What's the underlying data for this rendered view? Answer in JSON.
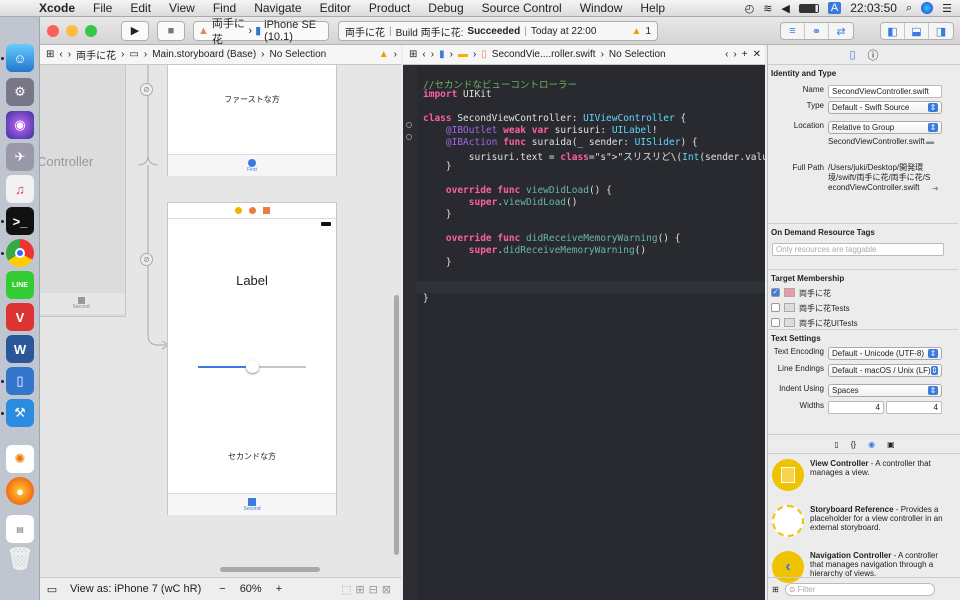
{
  "menubar": {
    "app": "Xcode",
    "items": [
      "File",
      "Edit",
      "View",
      "Find",
      "Navigate",
      "Editor",
      "Product",
      "Debug",
      "Source Control",
      "Window",
      "Help"
    ],
    "user_initial": "A",
    "clock": "22:03:50"
  },
  "toolbar": {
    "scheme": "両手に花",
    "device": "iPhone SE (10.1)",
    "status_app": "両手に花",
    "status_build": "Build 両手に花:",
    "status_result": "Succeeded",
    "status_time": "Today at 22:00",
    "warning_count": "1"
  },
  "canvas_jump": {
    "project": "両手に花",
    "file": "Main.storyboard (Base)",
    "selection": "No Selection"
  },
  "editor_jump": {
    "file": "SecondVie....roller.swift",
    "selection": "No Selection"
  },
  "storyboard": {
    "first_title": "ファーストな方",
    "first_tab": "First",
    "ghost": "Controller",
    "ghost_tab": "Second",
    "label": "Label",
    "second_title": "セカンドな方",
    "second_tab": "Second",
    "slider_value": 0.5
  },
  "canvas_bar": {
    "view_as": "View as: iPhone 7 (wC hR)",
    "zoom": "60%",
    "minus": "−",
    "plus": "+"
  },
  "code": [
    "//セカンドなビューコントローラー",
    "import UIKit",
    "",
    "class SecondViewController: UIViewController {",
    "    @IBOutlet weak var surisuri: UILabel!",
    "    @IBAction func suraida(_ sender: UISlider) {",
    "        surisuri.text = \"スリスリど\\(Int(sender.value))%\"",
    "    }",
    "",
    "    override func viewDidLoad() {",
    "        super.viewDidLoad()",
    "    }",
    "",
    "    override func didReceiveMemoryWarning() {",
    "        super.didReceiveMemoryWarning()",
    "    }",
    "",
    "",
    "}"
  ],
  "inspector": {
    "identity_head": "Identity and Type",
    "name_lbl": "Name",
    "name_val": "SecondViewController.swift",
    "type_lbl": "Type",
    "type_val": "Default - Swift Source",
    "loc_lbl": "Location",
    "loc_val": "Relative to Group",
    "loc_file": "SecondViewController.swift",
    "fullpath_lbl": "Full Path",
    "fullpath_val": "/Users/juki/Desktop/開発環境/swift/両手に花/両手に花/SecondViewController.swift",
    "odr_head": "On Demand Resource Tags",
    "odr_placeholder": "Only resources are taggable",
    "tm_head": "Target Membership",
    "targets": [
      "両手に花",
      "両手に花Tests",
      "両手に花UITests"
    ],
    "ts_head": "Text Settings",
    "enc_lbl": "Text Encoding",
    "enc_val": "Default - Unicode (UTF-8)",
    "le_lbl": "Line Endings",
    "le_val": "Default - macOS / Unix (LF)",
    "indent_lbl": "Indent Using",
    "indent_val": "Spaces",
    "widths_lbl": "Widths",
    "tab_w": "4",
    "indent_w": "4"
  },
  "library": [
    {
      "title": "View Controller",
      "desc": " - A controller that manages a view."
    },
    {
      "title": "Storyboard Reference",
      "desc": " - Provides a placeholder for a view controller in an external storyboard."
    },
    {
      "title": "Navigation Controller",
      "desc": " - A controller that manages navigation through a hierarchy of views."
    }
  ],
  "filter_placeholder": "Filter"
}
